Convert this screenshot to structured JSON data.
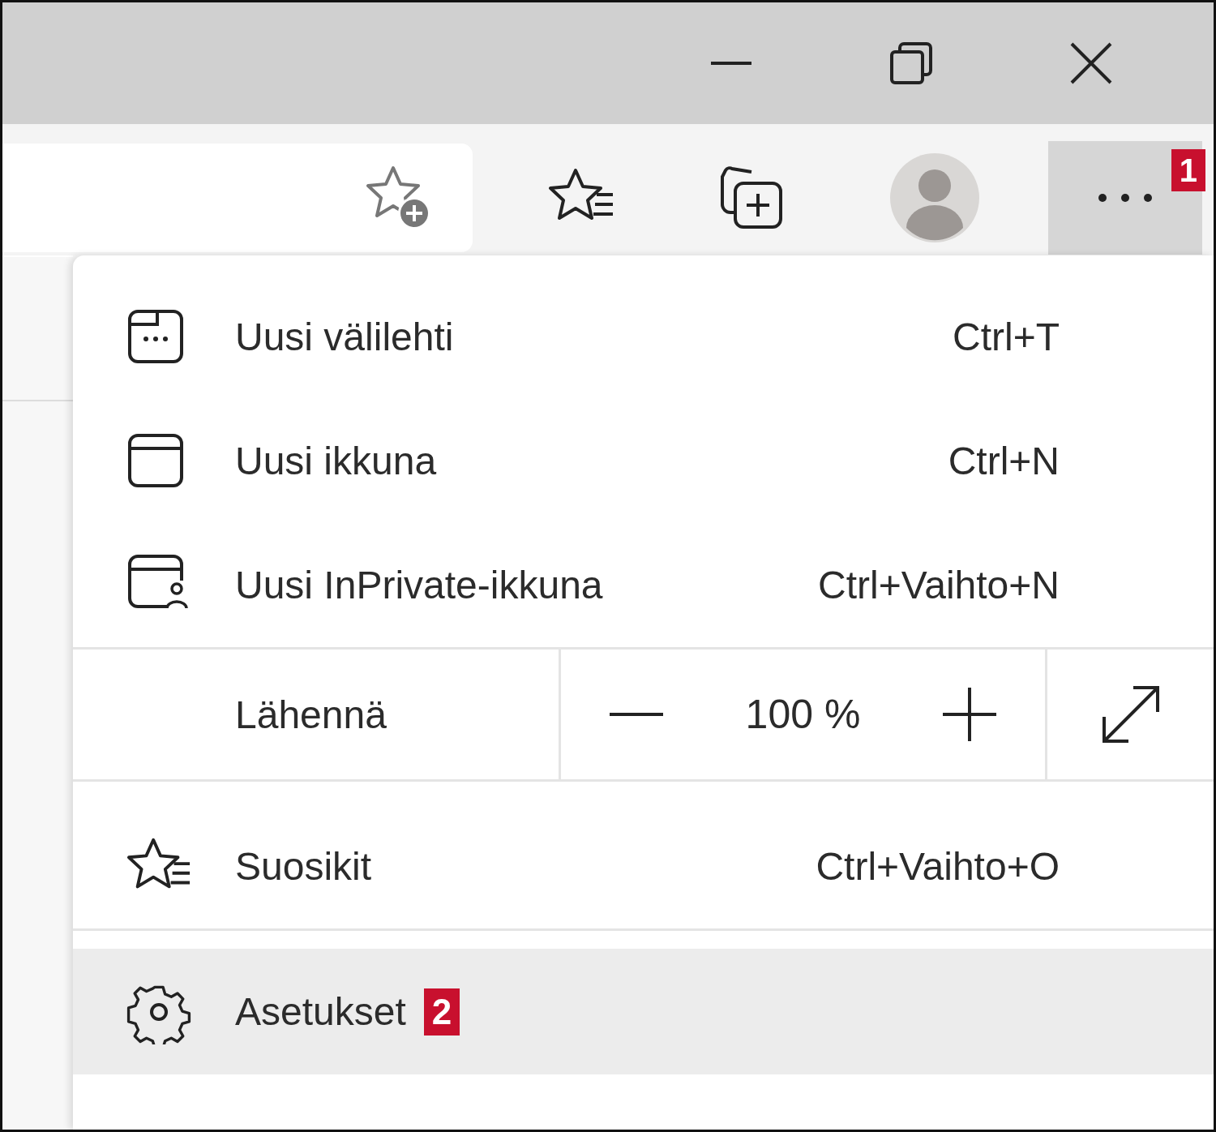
{
  "toolbar": {
    "more_badge": "1"
  },
  "menu": {
    "items": [
      {
        "kind": "item",
        "label": "Uusi välilehti",
        "shortcut": "Ctrl+T",
        "selected": false
      },
      {
        "kind": "item",
        "label": "Uusi ikkuna",
        "shortcut": "Ctrl+N",
        "selected": false
      },
      {
        "kind": "item",
        "label": "Uusi InPrivate-ikkuna",
        "shortcut": "Ctrl+Vaihto+N",
        "selected": false
      },
      {
        "kind": "zoom",
        "label": "Lähennä",
        "value": "100 %"
      },
      {
        "kind": "item",
        "label": "Suosikit",
        "shortcut": "Ctrl+Vaihto+O",
        "selected": false
      },
      {
        "kind": "item",
        "label": "Asetukset",
        "badge": "2",
        "selected": true
      }
    ]
  }
}
